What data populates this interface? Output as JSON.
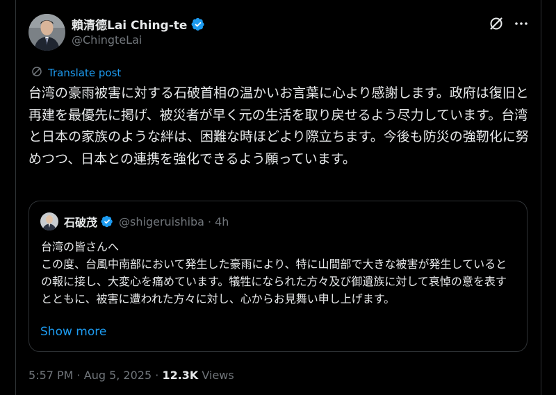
{
  "author": {
    "name": "賴清德Lai Ching-te",
    "handle": "@ChingteLai"
  },
  "translate": {
    "label": "Translate post"
  },
  "post": {
    "text": "台湾の豪雨被害に対する石破首相の温かいお言葉に心より感謝します。政府は復旧と再建を最優先に掲げ、被災者が早く元の生活を取り戻せるよう尽力しています。台湾と日本の家族のような絆は、困難な時ほどより際立ちます。今後も防災の強靭化に努めつつ、日本との連携を強化できるよう願っています。"
  },
  "quote": {
    "name": "石破茂",
    "handle": "@shigeruishiba",
    "separator": "·",
    "time": "4h",
    "text_line1": "台湾の皆さんへ",
    "text_body": "この度、台風中南部において発生した豪雨により、特に山間部で大きな被害が発生しているとの報に接し、大変心を痛めています。犠牲になられた方々及び御遺族に対して哀悼の意を表すとともに、被害に遭われた方々に対し、心からお見舞い申し上げます。",
    "show_more": "Show more"
  },
  "meta": {
    "time": "5:57 PM",
    "date": "Aug 5, 2025",
    "separator": "·",
    "views_count": "12.3K",
    "views_label": "Views"
  },
  "colors": {
    "background": "#000000",
    "text": "#e7e9ea",
    "secondary": "#71767b",
    "accent": "#1d9bf0",
    "border": "#2f3336"
  }
}
